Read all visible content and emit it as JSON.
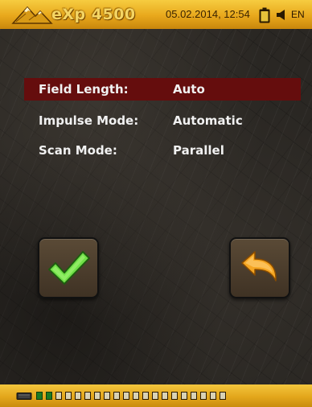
{
  "statusbar": {
    "logo_text": "eXp 4500",
    "datetime": "05.02.2014, 12:54",
    "battery_icon": "battery-icon",
    "speaker_icon": "speaker-icon",
    "language": "EN"
  },
  "settings": {
    "rows": [
      {
        "label": "Field Length:",
        "value": "Auto",
        "selected": true
      },
      {
        "label": "Impulse Mode:",
        "value": "Automatic",
        "selected": false
      },
      {
        "label": "Scan Mode:",
        "value": "Parallel",
        "selected": false
      }
    ]
  },
  "buttons": {
    "confirm_icon": "checkmark-icon",
    "back_icon": "back-arrow-icon"
  },
  "memory_indicator": {
    "icon": "memory-chip-icon",
    "segments_total": 20,
    "segments_filled": 2
  },
  "colors": {
    "bar_gold": "#e8a81c",
    "selection_red": "#650d0d",
    "check_green": "#6fe046",
    "arrow_orange": "#f5a623",
    "memory_green": "#1c7a24"
  }
}
